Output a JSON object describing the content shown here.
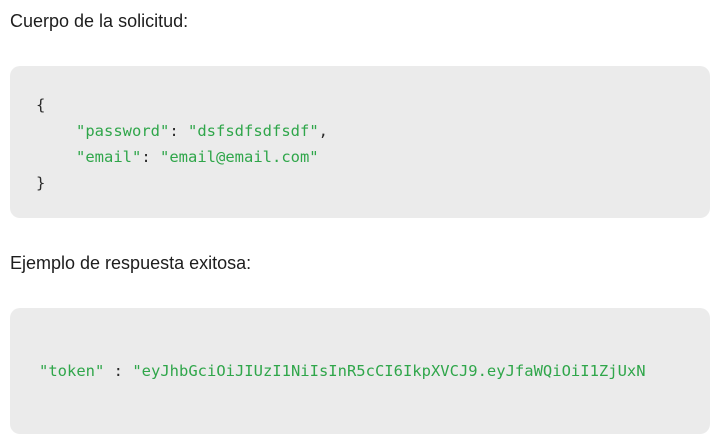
{
  "request_section": {
    "label": "Cuerpo de la solicitud:",
    "open_brace": "{",
    "close_brace": "}",
    "fields": [
      {
        "key": "\"password\"",
        "sep": ": ",
        "value": "\"dsfsdfsdfsdf\"",
        "trail": ","
      },
      {
        "key": "\"email\"",
        "sep": ": ",
        "value": "\"email@email.com\"",
        "trail": ""
      }
    ]
  },
  "response_section": {
    "label": "Ejemplo de respuesta exitosa:",
    "key": "\"token\"",
    "sep": " : ",
    "value": "\"eyJhbGciOiJIUzI1NiIsInR5cCI6IkpXVCJ9.eyJfaWQiOiI1ZjUxN"
  },
  "colors": {
    "code_background": "#ebebeb",
    "string": "#2fa64a",
    "punctuation": "#2b2b2b"
  }
}
